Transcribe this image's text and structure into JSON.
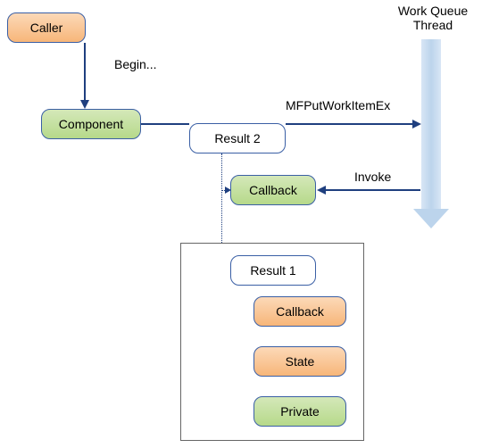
{
  "nodes": {
    "caller": "Caller",
    "component": "Component",
    "result2": "Result 2",
    "callback_green": "Callback",
    "result1": "Result 1",
    "callback_orange": "Callback",
    "state": "State",
    "private": "Private"
  },
  "edges": {
    "begin": "Begin...",
    "put": "MFPutWorkItemEx",
    "invoke": "Invoke"
  },
  "thread": {
    "title_line1": "Work Queue",
    "title_line2": "Thread"
  },
  "chart_data": {
    "type": "diagram",
    "title": "",
    "nodes": [
      {
        "id": "caller",
        "label": "Caller",
        "style": "orange"
      },
      {
        "id": "component",
        "label": "Component",
        "style": "green"
      },
      {
        "id": "result2",
        "label": "Result 2",
        "style": "white"
      },
      {
        "id": "callback_green",
        "label": "Callback",
        "style": "green"
      },
      {
        "id": "result1",
        "label": "Result 1",
        "style": "white",
        "group": "inner"
      },
      {
        "id": "callback_orange",
        "label": "Callback",
        "style": "orange",
        "group": "inner"
      },
      {
        "id": "state",
        "label": "State",
        "style": "orange",
        "group": "inner"
      },
      {
        "id": "private",
        "label": "Private",
        "style": "green",
        "group": "inner"
      },
      {
        "id": "work_queue_thread",
        "label": "Work Queue Thread",
        "style": "thread-bar"
      }
    ],
    "edges": [
      {
        "from": "caller",
        "to": "component",
        "label": "Begin...",
        "style": "solid"
      },
      {
        "from": "component",
        "to": "result2",
        "label": "",
        "style": "solid"
      },
      {
        "from": "result2",
        "to": "work_queue_thread",
        "label": "MFPutWorkItemEx",
        "style": "solid"
      },
      {
        "from": "work_queue_thread",
        "to": "callback_green",
        "label": "Invoke",
        "style": "solid"
      },
      {
        "from": "result2",
        "to": "callback_green",
        "label": "",
        "style": "dotted"
      },
      {
        "from": "result2",
        "to": "result1",
        "label": "",
        "style": "dotted"
      }
    ]
  }
}
